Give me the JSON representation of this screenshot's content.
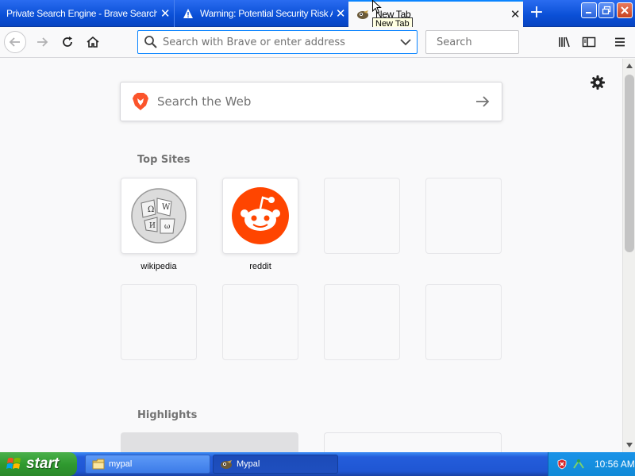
{
  "window": {
    "tabs": [
      {
        "title": "Private Search Engine - Brave Search"
      },
      {
        "title": "Warning: Potential Security Risk Ahead"
      },
      {
        "title": "New Tab"
      }
    ],
    "tooltip": "New Tab",
    "new_tab_label": "+"
  },
  "navbar": {
    "url_placeholder": "Search with Brave or enter address",
    "search_placeholder": "Search"
  },
  "content": {
    "web_search_placeholder": "Search the Web",
    "top_sites_title": "Top Sites",
    "top_sites": [
      {
        "label": "wikipedia",
        "icon": "wikipedia-globe-icon"
      },
      {
        "label": "reddit",
        "icon": "reddit-icon"
      },
      {
        "label": ""
      },
      {
        "label": ""
      },
      {
        "label": ""
      },
      {
        "label": ""
      },
      {
        "label": ""
      },
      {
        "label": ""
      }
    ],
    "highlights_title": "Highlights"
  },
  "taskbar": {
    "start_label": "start",
    "tasks": [
      {
        "label": "mypal",
        "icon": "folder-icon"
      },
      {
        "label": "Mypal",
        "icon": "mypal-icon"
      }
    ],
    "clock": "10:56 AM"
  },
  "colors": {
    "accent": "#0a84ff",
    "tabbar": "#0a4fd6",
    "reddit": "#ff4500",
    "brave": "#fb542b",
    "start_green": "#2f9a2f"
  }
}
